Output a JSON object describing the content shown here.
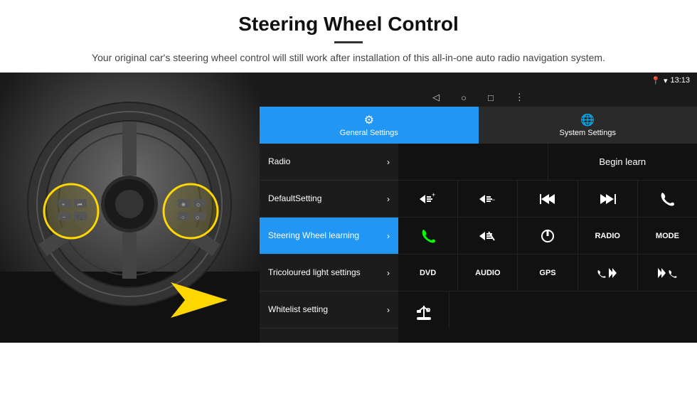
{
  "header": {
    "title": "Steering Wheel Control",
    "subtitle": "Your original car's steering wheel control will still work after installation of this all-in-one auto radio navigation system."
  },
  "statusBar": {
    "location_icon": "📍",
    "wifi_icon": "▾",
    "time": "13:13"
  },
  "navBar": {
    "back": "◁",
    "home": "○",
    "recent": "□",
    "menu": "⋮"
  },
  "tabs": [
    {
      "label": "General Settings",
      "active": true
    },
    {
      "label": "System Settings",
      "active": false
    }
  ],
  "menuItems": [
    {
      "label": "Radio",
      "active": false
    },
    {
      "label": "DefaultSetting",
      "active": false
    },
    {
      "label": "Steering Wheel learning",
      "active": true
    },
    {
      "label": "Tricoloured light settings",
      "active": false
    },
    {
      "label": "Whitelist setting",
      "active": false
    }
  ],
  "beginLearnButton": "Begin learn",
  "controlButtons": {
    "row1": [
      "🔊+",
      "🔊−",
      "⏮⏮",
      "⏭⏭",
      "📞"
    ],
    "row2": [
      "📞",
      "🔇",
      "⏻",
      "RADIO",
      "MODE"
    ],
    "row3": [
      "DVD",
      "AUDIO",
      "GPS",
      "📞⏮",
      "⏸⏭"
    ]
  }
}
